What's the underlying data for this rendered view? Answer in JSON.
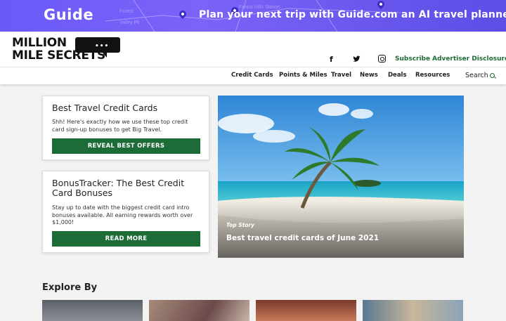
{
  "banner": {
    "logo": "Guide",
    "tagline": "Plan your next trip with Guide.com an AI travel planner",
    "map_labels": [
      "Forest Hills Station",
      "Forest",
      "Valley Pk"
    ],
    "colors": {
      "background": "#6a5af9",
      "text": "#ffffff"
    }
  },
  "brand": {
    "line1": "MILLION",
    "line2": "MILE SECRETS",
    "bubble_dots": "•••"
  },
  "social": {
    "facebook": "f",
    "twitter": "twitter-bird-icon",
    "instagram": "instagram-icon"
  },
  "header_links": {
    "subscribe": "Subscribe",
    "disclosure": "Advertiser Disclosure"
  },
  "nav": {
    "items": [
      "Credit Cards",
      "Points & Miles",
      "Travel",
      "News",
      "Deals",
      "Resources"
    ],
    "search_label": "Search"
  },
  "cards": [
    {
      "title": "Best Travel Credit Cards",
      "body": "Shh! Here's exactly how we use these top credit card sign-up bonuses to get Big Travel.",
      "button": "REVEAL BEST OFFERS"
    },
    {
      "title": "BonusTracker: The Best Credit Card Bonuses",
      "body": "Stay up to date with the biggest credit card intro bonuses available. All earning rewards worth over $1,000!",
      "button": "READ MORE"
    }
  ],
  "hero": {
    "label": "Top Story",
    "title": "Best travel credit cards of June 2021"
  },
  "explore": {
    "heading": "Explore By"
  },
  "accent_color": "#1d6b37"
}
